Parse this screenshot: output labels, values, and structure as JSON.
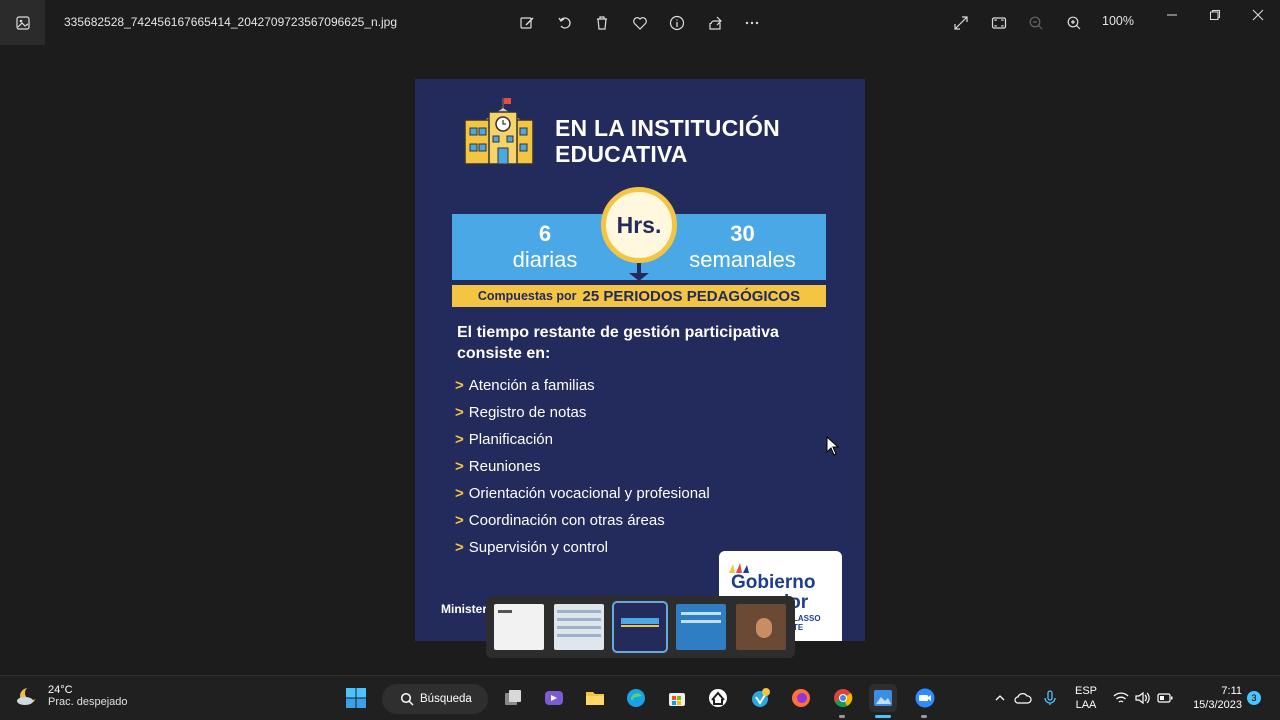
{
  "titlebar": {
    "filename": "335682528_742456167665414_2042709723567096625_n.jpg",
    "zoom_level": "100%"
  },
  "toolbar": {
    "icons": [
      "edit-image-icon",
      "rotate-icon",
      "delete-icon",
      "favorite-icon",
      "info-icon",
      "share-icon",
      "more-icon",
      "fullscreen-icon",
      "fit-to-window-icon",
      "zoom-out-icon",
      "zoom-in-icon"
    ]
  },
  "poster": {
    "header_line1": "EN LA INSTITUCIÓN",
    "header_line2": "EDUCATIVA",
    "clock_label": "Hrs.",
    "left_number": "6",
    "left_label": "diarias",
    "right_number": "30",
    "right_label": "semanales",
    "composed_prefix": "Compuestas por",
    "composed_main": "25 PERIODOS PEDAGÓGICOS",
    "subtitle": "El tiempo restante de gestión participativa consiste en:",
    "items": [
      "Atención a familias",
      "Registro de notas",
      "Planificación",
      "Reuniones",
      "Orientación vocacional y profesional",
      "Coordinación con otras áreas",
      "Supervisión y control"
    ],
    "bullet": ">",
    "gov_line1": "Gobierno",
    "gov_line2": "ador",
    "gov_sub1": "LASSO",
    "gov_sub2": "TE",
    "ministry": "Minister"
  },
  "taskbar": {
    "weather_temp": "24°C",
    "weather_desc": "Prac. despejado",
    "search_label": "Búsqueda",
    "lang_line1": "ESP",
    "lang_line2": "LAA",
    "time": "7:11",
    "date": "15/3/2023",
    "notification_count": "3"
  },
  "colors": {
    "poster_bg": "#232a5c",
    "band_blue": "#4aa8e6",
    "band_yellow": "#f4c542",
    "accent": "#62a8f0"
  }
}
